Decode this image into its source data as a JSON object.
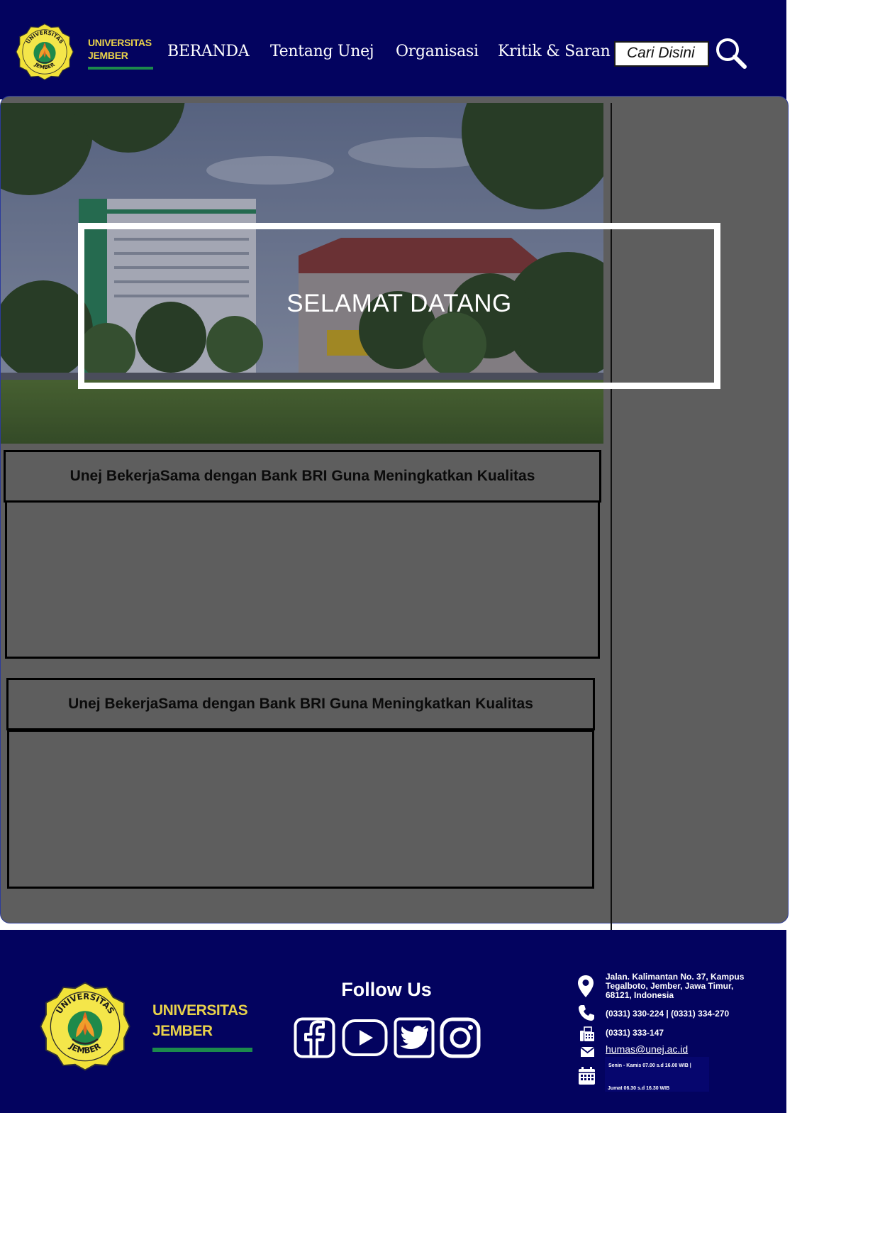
{
  "brand": {
    "line1": "UNIVERSITAS",
    "line2": "JEMBER",
    "seal_text_top": "UNIVERSITAS",
    "seal_text_bottom": "JEMBER",
    "color_navy": "#03035f",
    "color_gold": "#e9d24a",
    "color_green": "#1c8a4c"
  },
  "nav": {
    "items": [
      {
        "label": "BERANDA"
      },
      {
        "label": "Tentang Unej"
      },
      {
        "label": "Organisasi"
      },
      {
        "label": "Kritik & Saran"
      }
    ]
  },
  "search": {
    "placeholder": "Cari Disini",
    "icon": "search-icon"
  },
  "hero": {
    "welcome": "SELAMAT DATANG"
  },
  "news": [
    {
      "title": "Unej BekerjaSama dengan Bank BRI Guna Meningkatkan Kualitas"
    },
    {
      "title": "Unej BekerjaSama dengan Bank BRI Guna Meningkatkan Kualitas"
    }
  ],
  "footer": {
    "follow_title": "Follow Us",
    "social": [
      "facebook-icon",
      "youtube-icon",
      "twitter-icon",
      "instagram-icon"
    ],
    "contact": {
      "address": "Jalan. Kalimantan No. 37, Kampus Tegalboto, Jember, Jawa Timur, 68121, Indonesia",
      "phone": "(0331) 330-224 | (0331) 334-270",
      "fax": "(0331) 333-147",
      "email": "humas@unej.ac.id",
      "hours_line1": "Senin - Kamis 07.00 s.d 16.00 WIB |",
      "hours_line2": "Jumat 06.30 s.d 16.30 WIB"
    }
  }
}
